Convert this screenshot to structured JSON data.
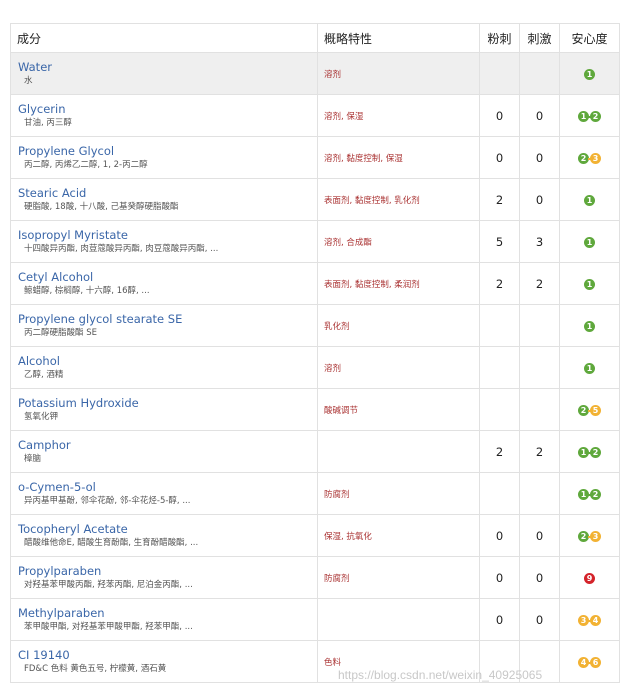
{
  "header": {
    "ingredient": "成分",
    "features": "概略特性",
    "acne": "粉刺",
    "irritation": "刺激",
    "safety": "安心度"
  },
  "colors": {
    "green": "#5fa83c",
    "orange": "#f2b233",
    "red": "#d4232a",
    "link": "#3a66a8"
  },
  "rows": [
    {
      "en": "Water",
      "zh": "水",
      "feat": "溶剂",
      "acne": "",
      "irr": "",
      "s1": "1",
      "c1": "#5fa83c",
      "s2": "",
      "c2": ""
    },
    {
      "en": "Glycerin",
      "zh": "甘油, 丙三醇",
      "feat": "溶剂, 保湿",
      "acne": "0",
      "irr": "0",
      "s1": "1",
      "c1": "#5fa83c",
      "s2": "2",
      "c2": "#5fa83c"
    },
    {
      "en": "Propylene Glycol",
      "zh": "丙二醇, 丙烯乙二醇, 1, 2-丙二醇",
      "feat": "溶剂, 黏度控制, 保湿",
      "acne": "0",
      "irr": "0",
      "s1": "2",
      "c1": "#5fa83c",
      "s2": "3",
      "c2": "#f2b233"
    },
    {
      "en": "Stearic Acid",
      "zh": "硬脂酸, 18酸, 十八酸, 己基癸醇硬脂酸酯",
      "feat": "表面剂, 黏度控制, 乳化剂",
      "acne": "2",
      "irr": "0",
      "s1": "1",
      "c1": "#5fa83c",
      "s2": "",
      "c2": ""
    },
    {
      "en": "Isopropyl Myristate",
      "zh": "十四酸异丙酯, 肉荳蔻酸异丙酯, 肉豆蔻酸异丙酯, ...",
      "feat": "溶剂, 合成酯",
      "acne": "5",
      "irr": "3",
      "s1": "1",
      "c1": "#5fa83c",
      "s2": "",
      "c2": ""
    },
    {
      "en": "Cetyl Alcohol",
      "zh": "鲸蜡醇, 棕榈醇, 十六醇, 16醇, ...",
      "feat": "表面剂, 黏度控制, 柔润剂",
      "acne": "2",
      "irr": "2",
      "s1": "1",
      "c1": "#5fa83c",
      "s2": "",
      "c2": ""
    },
    {
      "en": "Propylene glycol stearate SE",
      "zh": "丙二醇硬脂酸酯 SE",
      "feat": "乳化剂",
      "acne": "",
      "irr": "",
      "s1": "1",
      "c1": "#5fa83c",
      "s2": "",
      "c2": ""
    },
    {
      "en": "Alcohol",
      "zh": "乙醇, 酒精",
      "feat": "溶剂",
      "acne": "",
      "irr": "",
      "s1": "1",
      "c1": "#5fa83c",
      "s2": "",
      "c2": ""
    },
    {
      "en": "Potassium Hydroxide",
      "zh": "氢氧化钾",
      "feat": "酸碱调节",
      "acne": "",
      "irr": "",
      "s1": "2",
      "c1": "#5fa83c",
      "s2": "5",
      "c2": "#f2b233"
    },
    {
      "en": "Camphor",
      "zh": "樟脑",
      "feat": "",
      "acne": "2",
      "irr": "2",
      "s1": "1",
      "c1": "#5fa83c",
      "s2": "2",
      "c2": "#5fa83c"
    },
    {
      "en": "o-Cymen-5-ol",
      "zh": "异丙基甲基酚, 邻伞花酚, 邻-伞花烃-5-醇, ...",
      "feat": "防腐剂",
      "acne": "",
      "irr": "",
      "s1": "1",
      "c1": "#5fa83c",
      "s2": "2",
      "c2": "#5fa83c"
    },
    {
      "en": "Tocopheryl Acetate",
      "zh": "醋酸维他命E, 醋酸生育酚酯, 生育酚醋酸酯, ...",
      "feat": "保湿, 抗氧化",
      "acne": "0",
      "irr": "0",
      "s1": "2",
      "c1": "#5fa83c",
      "s2": "3",
      "c2": "#f2b233"
    },
    {
      "en": "Propylparaben",
      "zh": "对羟基苯甲酸丙酯, 羟苯丙酯, 尼泊金丙酯, ...",
      "feat": "防腐剂",
      "acne": "0",
      "irr": "0",
      "s1": "9",
      "c1": "#d4232a",
      "s2": "",
      "c2": ""
    },
    {
      "en": "Methylparaben",
      "zh": "苯甲酸甲酯, 对羟基苯甲酸甲酯, 羟苯甲酯, ...",
      "feat": "",
      "acne": "0",
      "irr": "0",
      "s1": "3",
      "c1": "#f2b233",
      "s2": "4",
      "c2": "#f2b233"
    },
    {
      "en": "CI 19140",
      "zh": "FD&C 色料 黄色五号, 柠檬黄, 酒石黄",
      "feat": "色料",
      "acne": "",
      "irr": "",
      "s1": "4",
      "c1": "#f2b233",
      "s2": "6",
      "c2": "#f2b233"
    }
  ],
  "watermark": "https://blog.csdn.net/weixin_40925065"
}
